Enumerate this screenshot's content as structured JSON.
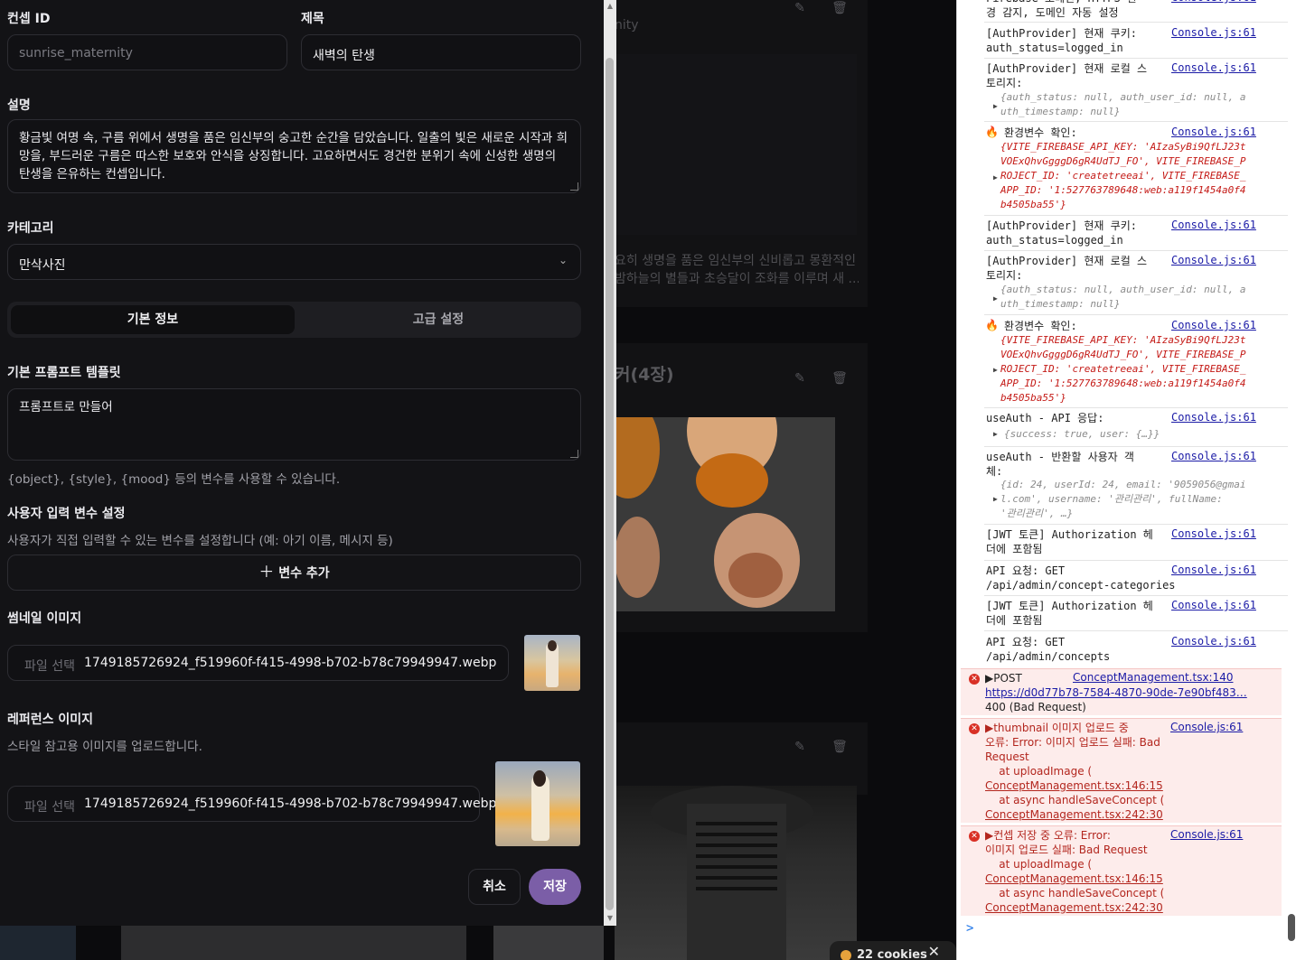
{
  "modal": {
    "concept_id_label": "컨셉 ID",
    "concept_id_value": "sunrise_maternity",
    "title_label": "제목",
    "title_value": "새벽의 탄생",
    "desc_label": "설명",
    "desc_value": "황금빛 여명 속, 구름 위에서 생명을 품은 임신부의 숭고한 순간을 담았습니다. 일출의 빛은 새로운 시작과 희망을, 부드러운 구름은 따스한 보호와 안식을 상징합니다. 고요하면서도 경건한 분위기 속에 신성한 생명의 탄생을 은유하는 컨셉입니다.",
    "category_label": "카테고리",
    "category_value": "만삭사진",
    "tab_basic": "기본 정보",
    "tab_advanced": "고급 설정",
    "prompt_label": "기본 프롬프트 템플릿",
    "prompt_value": "프롬프트로 만들어",
    "prompt_helper": "{object}, {style}, {mood} 등의 변수를 사용할 수 있습니다.",
    "vars_label": "사용자 입력 변수 설정",
    "vars_helper": "사용자가 직접 입력할 수 있는 변수를 설정합니다 (예: 아기 이름, 메시지 등)",
    "add_var_button": "변수 추가",
    "thumb_label": "썸네일 이미지",
    "thumb_choose": "파일 선택",
    "thumb_file": "1749185726924_f519960f-f415-4998-b702-b78c79949947.webp",
    "ref_label": "레퍼런스 이미지",
    "ref_helper": "스타일 참고용 이미지를 업로드합니다.",
    "ref_choose": "파일 선택",
    "ref_file": "1749185726924_f519960f-f415-4998-b702-b78c79949947.webp",
    "cancel_button": "취소",
    "save_button": "저장"
  },
  "background": {
    "frag_top": "nity",
    "frag_desc1": "요히 생명을 품은 임신부의 신비롭고 몽환적인",
    "frag_desc2": "밤하늘의 별들과 초승달이 조화를 이루며 새 ...",
    "frag_title": "커(4장)",
    "cookies": "22 cookies"
  },
  "colors": {
    "accent": "#7b5ea7",
    "error_bg": "#fdeceb",
    "error_text": "#b3261e",
    "link": "#1a1aa6"
  },
  "console": {
    "src": "Console.js:61",
    "l0": "Firebase 도메인, HTTPS 환\n경 감지, 도메인 자동 설정",
    "l1": "[AuthProvider] 현재 쿠키:\nauth_status=logged_in",
    "l2": "[AuthProvider] 현재 로컬 스\n토리지:",
    "l2o": "{auth_status: null, auth_user_id: null, a\nuth_timestamp: null}",
    "l3": "환경변수 확인:",
    "l3o": "{VITE_FIREBASE_API_KEY: 'AIzaSyBi9QfLJ23t\nVOExQhvGgggD6gR4UdTJ_FO', VITE_FIREBASE_P\nROJECT_ID: 'createtreeai', VITE_FIREBASE_\nAPP_ID: '1:527763789648:web:a119f1454a0f4\nb4505ba55'}",
    "l4": "[AuthProvider] 현재 쿠키:\nauth_status=logged_in",
    "l5": "[AuthProvider] 현재 로컬 스\n토리지:",
    "l5o": "{auth_status: null, auth_user_id: null, a\nuth_timestamp: null}",
    "l6": "환경변수 확인:",
    "l6o": "{VITE_FIREBASE_API_KEY: 'AIzaSyBi9QfLJ23t\nVOExQhvGgggD6gR4UdTJ_FO', VITE_FIREBASE_P\nROJECT_ID: 'createtreeai', VITE_FIREBASE_\nAPP_ID: '1:527763789648:web:a119f1454a0f4\nb4505ba55'}",
    "l7": "useAuth - API 응답:",
    "l7o": "{success: true, user: {…}}",
    "l8": "useAuth - 반환할 사용자 객\n체:",
    "l8o": "{id: 24, userId: 24, email: '9059056@gmai\nl.com', username: '관리관리', fullName:\n'관리관리', …}",
    "l9": "[JWT 토큰] Authorization 헤\n더에 포함됨",
    "l10": "API 요청: GET\n/api/admin/concept-categories",
    "l11": "[JWT 토큰] Authorization 헤\n더에 포함됨",
    "l12": "API 요청: GET\n/api/admin/concepts",
    "e1a": "▶POST",
    "e1src": "ConceptManagement.tsx:140",
    "e1url": "https://d0d77b78-7584-4870-90de-7e90bf483…",
    "e1b": "400 (Bad Request)",
    "e2a": "▶thumbnail 이미지 업로드 중\n오류: Error: 이미지 업로드 실패: Bad\nRequest\n    at uploadImage (",
    "e2l1": "ConceptManagement.tsx:146:15",
    "e2b": "    at async handleSaveConcept (",
    "e2l2": "ConceptManagement.tsx:242:30",
    "e3a": "▶컨셉 저장 중 오류: Error:\n이미지 업로드 실패: Bad Request\n    at uploadImage (",
    "e3l1": "ConceptManagement.tsx:146:15",
    "e3b": "    at async handleSaveConcept (",
    "e3l2": "ConceptManagement.tsx:242:30",
    "prompt": ">"
  }
}
